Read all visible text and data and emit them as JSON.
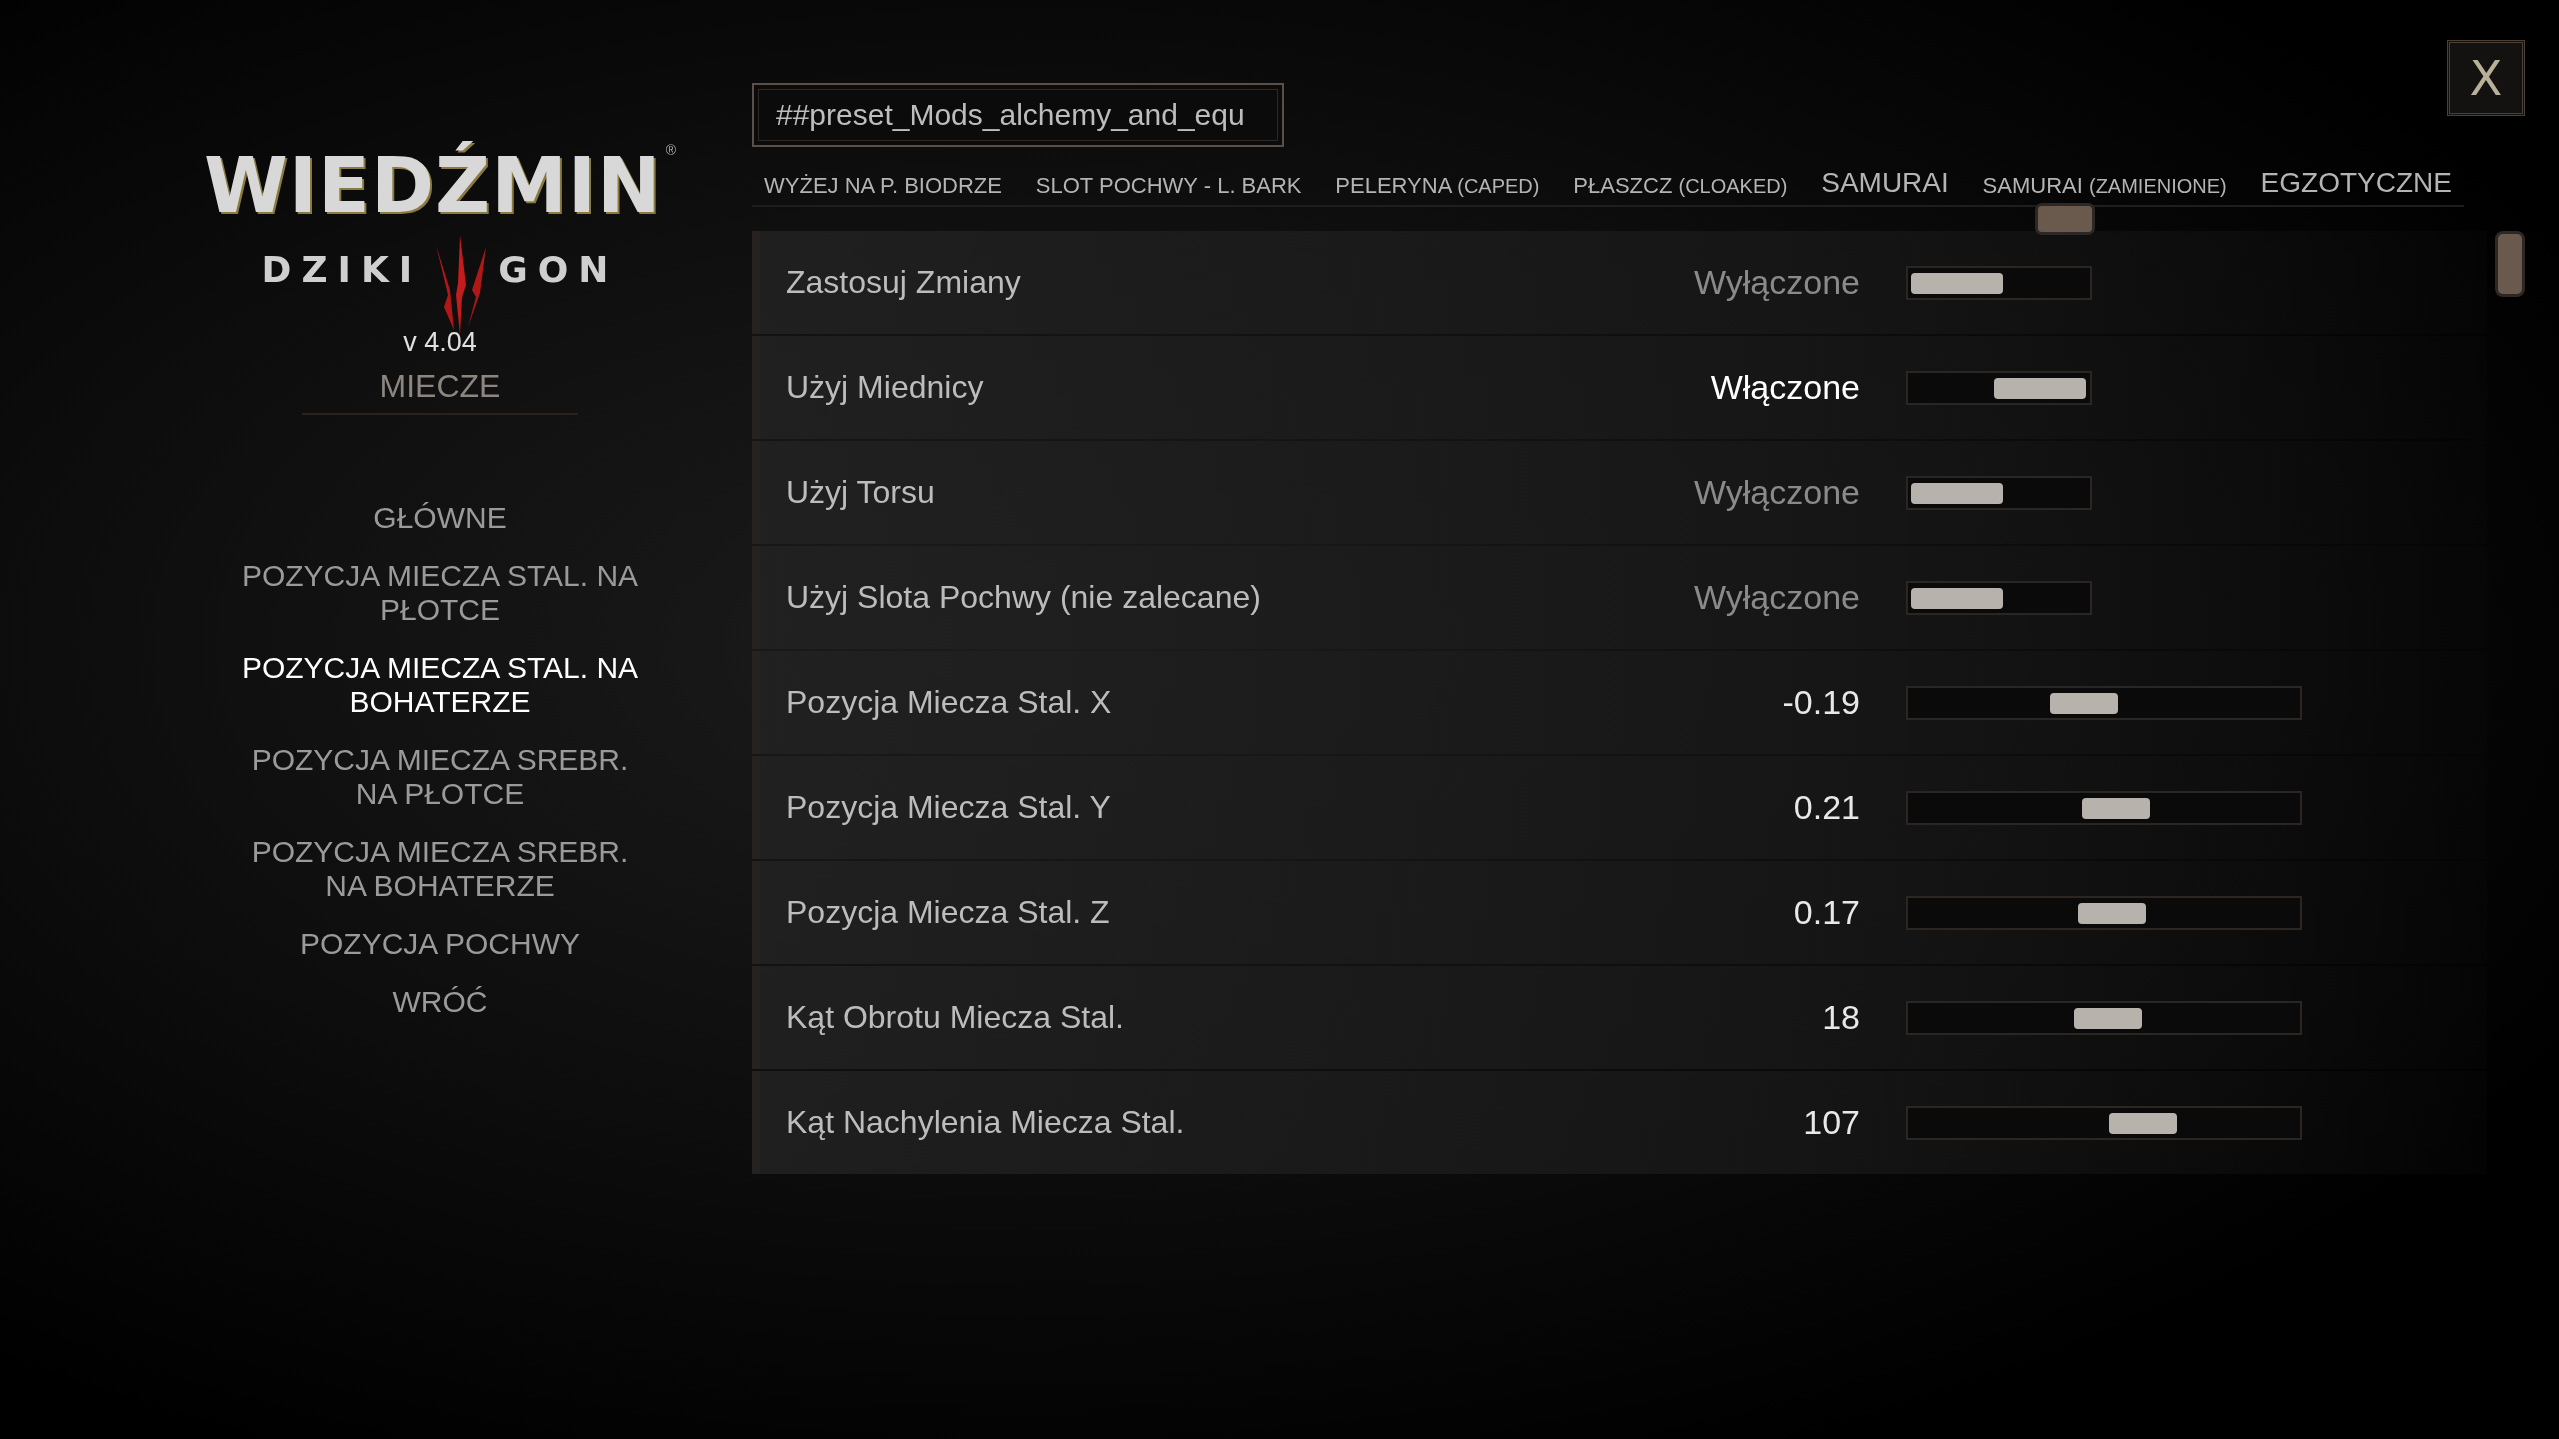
{
  "logo": {
    "title": "WIEDŹMIN",
    "registered": "®",
    "subtitle_left": "DZIKI",
    "subtitle_right": "GON"
  },
  "version": "v 4.04",
  "section_title": "MIECZE",
  "menu": [
    {
      "label": "GŁÓWNE",
      "selected": false
    },
    {
      "label": "POZYCJA MIECZA STAL. NA PŁOTCE",
      "selected": false
    },
    {
      "label": "POZYCJA MIECZA STAL. NA BOHATERZE",
      "selected": true
    },
    {
      "label": "POZYCJA MIECZA SREBR. NA PŁOTCE",
      "selected": false
    },
    {
      "label": "POZYCJA MIECZA SREBR. NA BOHATERZE",
      "selected": false
    },
    {
      "label": "POZYCJA POCHWY",
      "selected": false
    },
    {
      "label": "WRÓĆ",
      "selected": false
    }
  ],
  "preset_field": {
    "value": "##preset_Mods_alchemy_and_equ"
  },
  "close_button": "X",
  "tabs": [
    {
      "label": "WYŻEJ NA P. BIODRZE"
    },
    {
      "label": "SLOT POCHWY - L. BARK"
    },
    {
      "label": "PELERYNA",
      "note": "(CAPED)"
    },
    {
      "label": "PŁASZCZ",
      "note": "(CLOAKED)"
    },
    {
      "label": "SAMURAI"
    },
    {
      "label": "SAMURAI",
      "note": "(ZAMIENIONE)"
    },
    {
      "label": "EGZOTYCZNE"
    }
  ],
  "settings": [
    {
      "kind": "toggle",
      "label": "Zastosuj Zmiany",
      "value": "Wyłączone",
      "on": false
    },
    {
      "kind": "toggle",
      "label": "Użyj Miednicy",
      "value": "Włączone",
      "on": true
    },
    {
      "kind": "toggle",
      "label": "Użyj Torsu",
      "value": "Wyłączone",
      "on": false
    },
    {
      "kind": "toggle",
      "label": "Użyj Slota Pochwy (nie zalecane)",
      "value": "Wyłączone",
      "on": false
    },
    {
      "kind": "slider",
      "label": "Pozycja Miecza Stal. X",
      "value": "-0.19",
      "level": 0.45
    },
    {
      "kind": "slider",
      "label": "Pozycja Miecza Stal. Y",
      "value": "0.21",
      "level": 0.53
    },
    {
      "kind": "slider",
      "label": "Pozycja Miecza Stal. Z",
      "value": "0.17",
      "level": 0.52
    },
    {
      "kind": "slider",
      "label": "Kąt Obrotu Miecza Stal.",
      "value": "18",
      "level": 0.51
    },
    {
      "kind": "slider",
      "label": "Kąt Nachylenia Miecza Stal.",
      "value": "107",
      "level": 0.6
    }
  ]
}
